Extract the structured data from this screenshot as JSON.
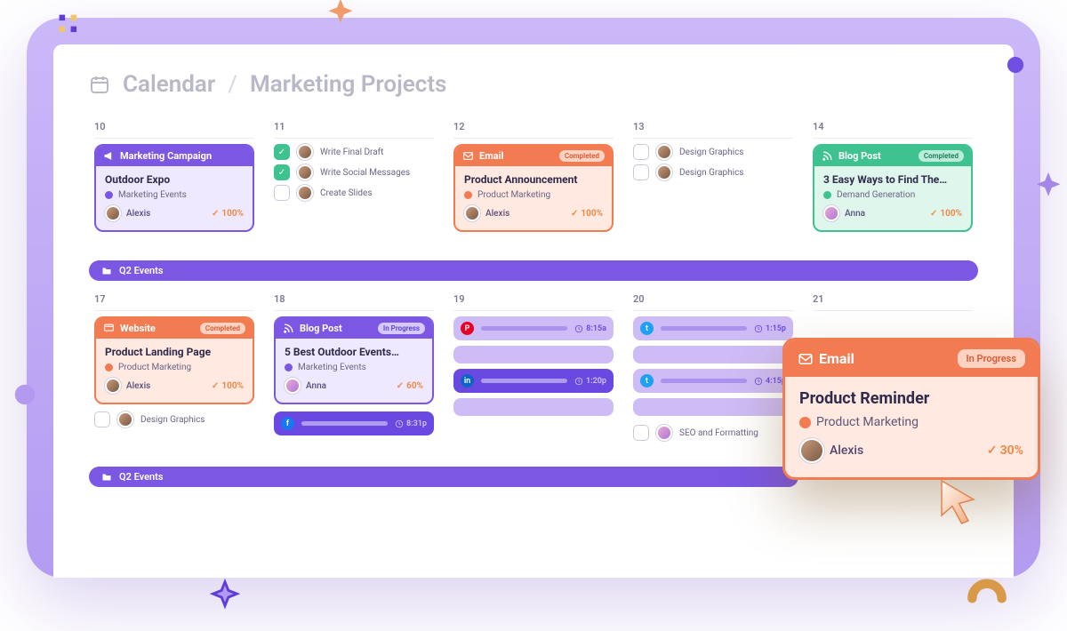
{
  "header": {
    "title": "Calendar",
    "sub": "Marketing Projects"
  },
  "row1": {
    "days": [
      "10",
      "11",
      "12",
      "13",
      "14"
    ],
    "span_label": "Q2 Events"
  },
  "row2": {
    "days": [
      "17",
      "18",
      "19",
      "20",
      "21"
    ],
    "span_label": "Q2 Events"
  },
  "d10": {
    "card": {
      "type_label": "Marketing Campaign",
      "title": "Outdoor Expo",
      "tag": "Marketing Events",
      "assignee": "Alexis",
      "pct": "100%"
    }
  },
  "d11": {
    "tasks": [
      {
        "done": true,
        "label": "Write Final Draft"
      },
      {
        "done": true,
        "label": "Write Social Messages"
      },
      {
        "done": false,
        "label": "Create Slides"
      }
    ]
  },
  "d12": {
    "card": {
      "type_label": "Email",
      "status": "Completed",
      "title": "Product Announcement",
      "tag": "Product Marketing",
      "assignee": "Alexis",
      "pct": "100%"
    }
  },
  "d13": {
    "tasks": [
      {
        "done": false,
        "label": "Design Graphics"
      },
      {
        "done": false,
        "label": "Design Graphics"
      }
    ]
  },
  "d14": {
    "card": {
      "type_label": "Blog Post",
      "status": "Completed",
      "title": "3 Easy Ways to Find The…",
      "tag": "Demand Generation",
      "assignee": "Anna",
      "pct": "100%"
    }
  },
  "d17": {
    "card": {
      "type_label": "Website",
      "status": "Completed",
      "title": "Product Landing Page",
      "tag": "Product Marketing",
      "assignee": "Alexis",
      "pct": "100%"
    },
    "task": {
      "label": "Design Graphics"
    }
  },
  "d18": {
    "card": {
      "type_label": "Blog Post",
      "status": "In Progress",
      "title": "5 Best Outdoor Events…",
      "tag": "Marketing Events",
      "assignee": "Anna",
      "pct": "60%"
    },
    "chip": {
      "network": "fb",
      "time": "8:31p"
    }
  },
  "d19": {
    "chips": [
      {
        "network": "pin",
        "time": "8:15a",
        "solid": false
      },
      {
        "network": "li",
        "time": "1:20p",
        "solid": true
      }
    ]
  },
  "d20": {
    "chips": [
      {
        "network": "tw",
        "time": "1:15p",
        "solid": false
      },
      {
        "network": "tw",
        "time": "4:15p",
        "solid": false
      }
    ],
    "task": {
      "label": "SEO and Formatting"
    }
  },
  "popover": {
    "type_label": "Email",
    "status": "In Progress",
    "title": "Product Reminder",
    "tag": "Product Marketing",
    "assignee": "Alexis",
    "pct": "30%"
  },
  "colors": {
    "purple": "#7b57e4",
    "orange": "#f27b52",
    "green": "#3ec28f",
    "dot_events": "#7b57e4",
    "dot_product": "#f27b52",
    "dot_demand": "#3ec28f"
  }
}
